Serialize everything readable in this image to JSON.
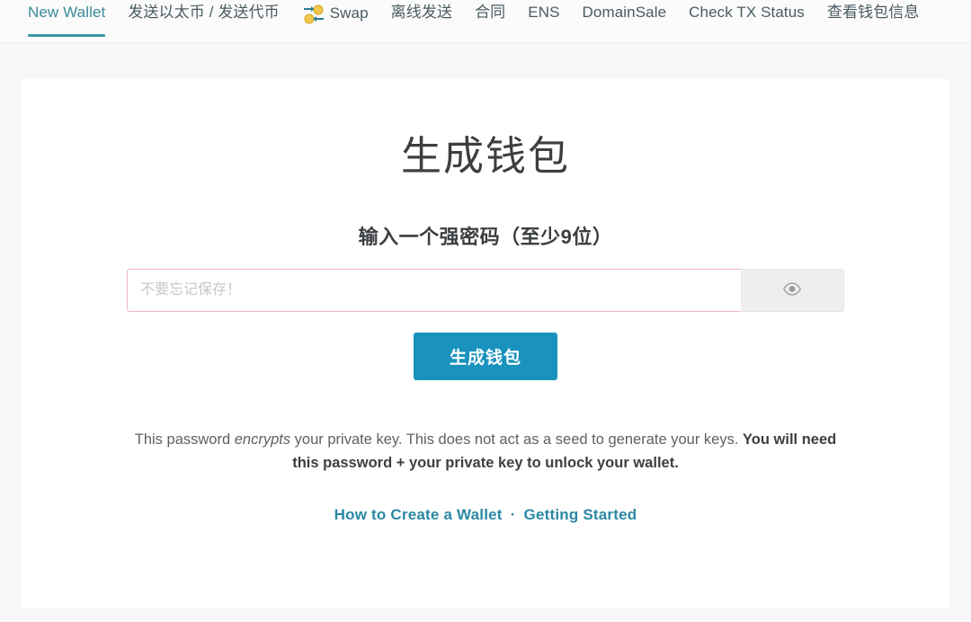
{
  "nav": {
    "items": [
      {
        "label": "New Wallet",
        "active": true,
        "icon": null
      },
      {
        "label": "发送以太币 / 发送代币",
        "active": false,
        "icon": null
      },
      {
        "label": "Swap",
        "active": false,
        "icon": "swap-coins-icon"
      },
      {
        "label": "离线发送",
        "active": false,
        "icon": null
      },
      {
        "label": "合同",
        "active": false,
        "icon": null
      },
      {
        "label": "ENS",
        "active": false,
        "icon": null
      },
      {
        "label": "DomainSale",
        "active": false,
        "icon": null
      },
      {
        "label": "Check TX Status",
        "active": false,
        "icon": null
      },
      {
        "label": "查看钱包信息",
        "active": false,
        "icon": null
      }
    ],
    "active_color": "#3b96a8",
    "text_color": "#4a5a61"
  },
  "main": {
    "title": "生成钱包",
    "subtitle": "输入一个强密码（至少9位）",
    "password": {
      "value": "",
      "placeholder": "不要忘记保存！",
      "border_color": "#f0b9bd",
      "toggle_icon": "eye-icon"
    },
    "generate_button": {
      "label": "生成钱包",
      "color": "#1993bd"
    },
    "note": {
      "part1": "This password ",
      "emphasis": "encrypts",
      "part2": " your private key. This does not act as a seed to generate your keys. ",
      "bold": "You will need this password + your private key to unlock your wallet."
    },
    "links": {
      "first": "How to Create a Wallet",
      "separator": "·",
      "second": "Getting Started",
      "color": "#2b88a4"
    }
  }
}
